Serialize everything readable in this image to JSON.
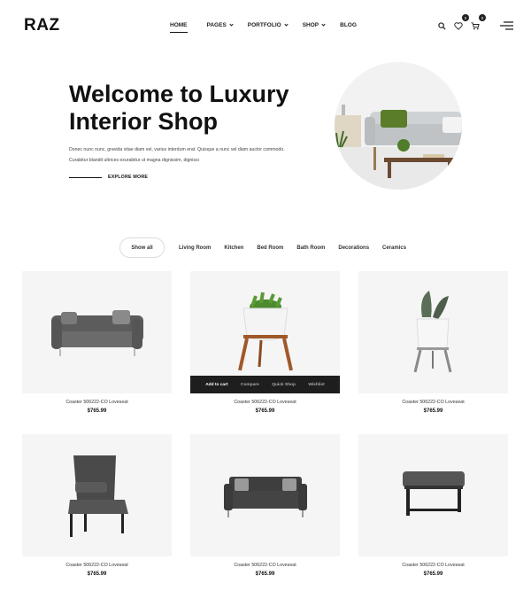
{
  "header": {
    "logo": "RAZ",
    "nav": [
      {
        "label": "HOME",
        "has_caret": false
      },
      {
        "label": "PAGES",
        "has_caret": true
      },
      {
        "label": "PORTFOLIO",
        "has_caret": true
      },
      {
        "label": "SHOP",
        "has_caret": true
      },
      {
        "label": "BLOG",
        "has_caret": false
      }
    ],
    "icons": [
      "search-icon",
      "heart-icon",
      "cart-icon",
      "menu-icon"
    ],
    "wishlist_count": "0",
    "cart_count": "0"
  },
  "hero": {
    "title_line1": "Welcome to Luxury",
    "title_line2": "Interior Shop",
    "text_line1": "Donec nunc nunc, gravida vitae diam vel, varius interdum erat. Quisque a nunc vel diam auctor commodo.",
    "text_line2": "Curabitur blandit ultrices exurabitur ut magna dignissim, dignissi",
    "cta": "EXPLORE MORE"
  },
  "filters": [
    "Show all",
    "Living Room",
    "Kitchen",
    "Bed Room",
    "Bath Room",
    "Decorations",
    "Ceramics"
  ],
  "products": [
    {
      "name": "Coaster 506222-CO Loveseat",
      "price": "$765.99",
      "image": "sofa"
    },
    {
      "name": "Coaster 506222-CO Loveseat",
      "price": "$765.99",
      "image": "plant-stand"
    },
    {
      "name": "Coaster 506222-CO Loveseat",
      "price": "$765.99",
      "image": "plant-pot"
    },
    {
      "name": "Coaster 506222-CO Loveseat",
      "price": "$765.99",
      "image": "chair"
    },
    {
      "name": "Coaster 506222-CO Loveseat",
      "price": "$765.99",
      "image": "loveseat"
    },
    {
      "name": "Coaster 506222-CO Loveseat",
      "price": "$765.99",
      "image": "ottoman"
    }
  ],
  "product_actions": [
    "Add to cart",
    "Compare",
    "Quick Shop",
    "Wishlist"
  ]
}
